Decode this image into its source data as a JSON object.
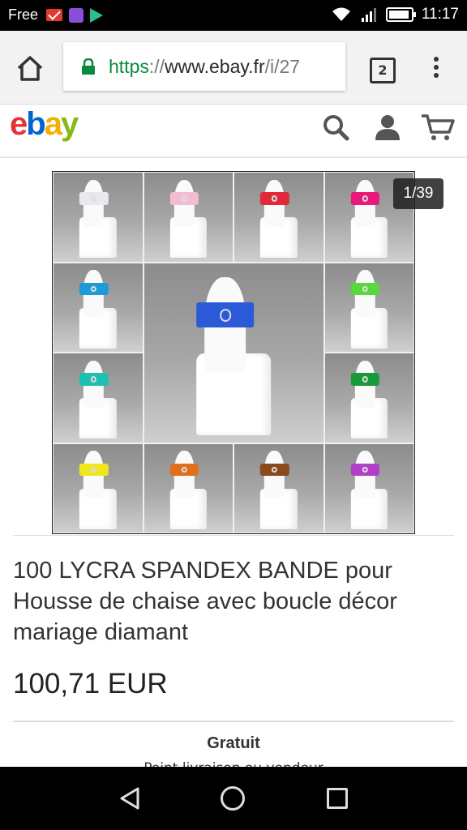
{
  "status_bar": {
    "carrier": "Free",
    "time": "11:17"
  },
  "browser": {
    "url_scheme": "https",
    "url_separator": "://",
    "url_host": "www.ebay.fr",
    "url_path": "/i/27",
    "tab_count": "2"
  },
  "ebay": {
    "logo_letters": [
      "e",
      "b",
      "a",
      "y"
    ],
    "logo_colors": {
      "e": "#e53238",
      "b": "#0064d2",
      "a": "#f5af02",
      "y": "#86b817"
    }
  },
  "gallery": {
    "counter": "1/39",
    "sash_colors": [
      "#e8e8ee",
      "#f4bcd2",
      "#e02a3a",
      "#e8197a",
      "#1e9ad8",
      "#58d83e",
      "#1fc0b0",
      "#189a3a",
      "#f0e620",
      "#e07020",
      "#8a4a1c",
      "#b040c8",
      "#2a5ad8"
    ]
  },
  "product": {
    "title": "100 LYCRA SPANDEX BANDE pour Housse de chaise avec boucle décor mariage diamant",
    "price": "100,71 EUR",
    "shipping": "Gratuit",
    "shipping_note": "Point livraison ou vendeur"
  }
}
